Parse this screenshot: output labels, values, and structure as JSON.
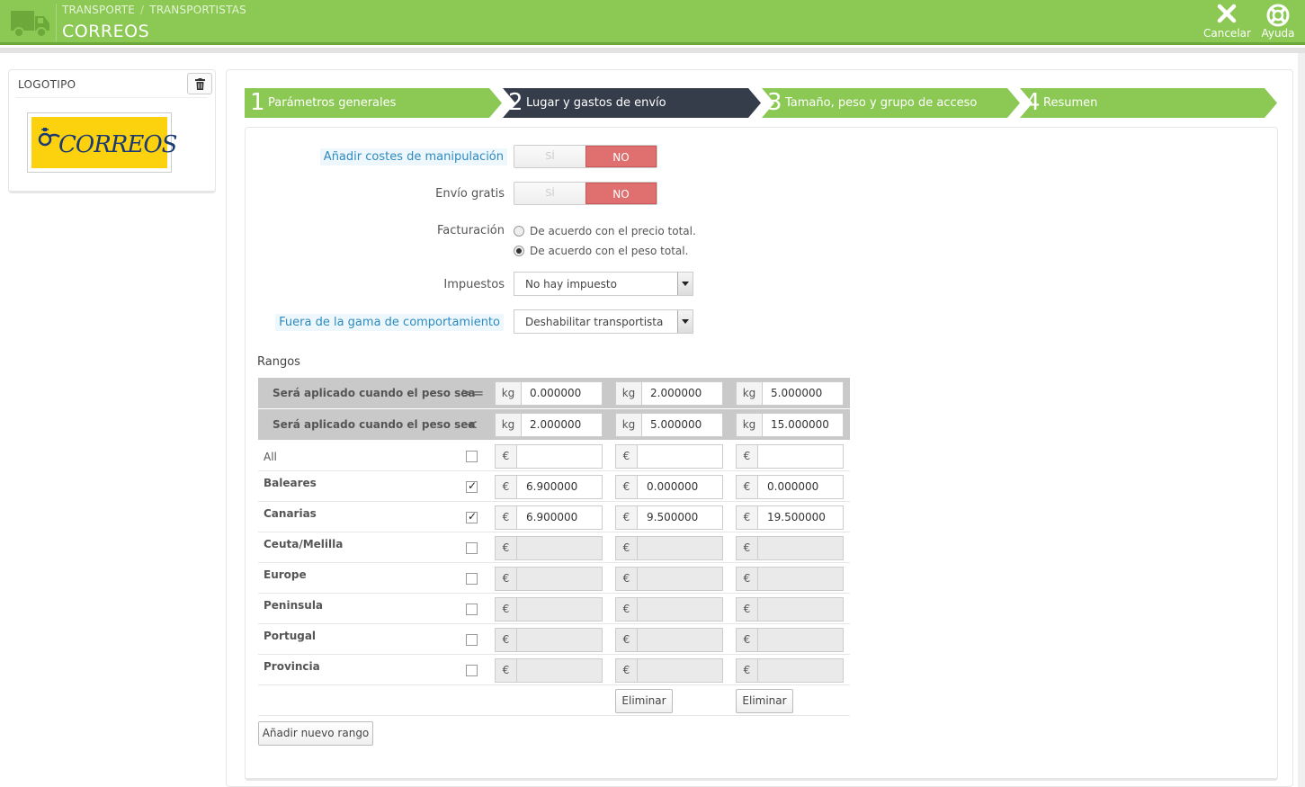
{
  "header": {
    "breadcrumb": [
      "TRANSPORTE",
      "TRANSPORTISTAS"
    ],
    "breadcrumb_sep": "/",
    "title": "CORREOS",
    "cancel_label": "Cancelar",
    "help_label": "Ayuda"
  },
  "logo_panel": {
    "title": "LOGOTIPO",
    "brand_text": "CORREOS"
  },
  "steps": [
    {
      "num": "1",
      "label": "Parámetros generales",
      "active": false
    },
    {
      "num": "2",
      "label": "Lugar y gastos de envío",
      "active": true
    },
    {
      "num": "3",
      "label": "Tamaño, peso y grupo de acceso",
      "active": false
    },
    {
      "num": "4",
      "label": "Resumen",
      "active": false
    }
  ],
  "form": {
    "handling_label": "Añadir costes de manipulación",
    "free_label": "Envío gratis",
    "toggle_yes": "SÍ",
    "toggle_no": "NO",
    "billing_label": "Facturación",
    "billing_options": [
      "De acuerdo con el precio total.",
      "De acuerdo con el peso total."
    ],
    "billing_selected": 1,
    "tax_label": "Impuestos",
    "tax_value": "No hay impuesto",
    "outofrange_label": "Fuera de la gama de comportamiento",
    "outofrange_value": "Deshabilitar transportista"
  },
  "ranges": {
    "title": "Rangos",
    "row_ge_label": "Será aplicado cuando el peso sea",
    "row_ge_op": ">=",
    "row_lt_label": "Será aplicado cuando el peso sea",
    "row_lt_op": "<",
    "unit": "kg",
    "currency": "€",
    "from": [
      "0.000000",
      "2.000000",
      "5.000000"
    ],
    "to": [
      "2.000000",
      "5.000000",
      "15.000000"
    ],
    "zones": [
      {
        "name": "All",
        "checked": false,
        "values": [
          "",
          "",
          ""
        ],
        "enabled": true
      },
      {
        "name": "Baleares",
        "checked": true,
        "values": [
          "6.900000",
          "0.000000",
          "0.000000"
        ],
        "enabled": true
      },
      {
        "name": "Canarias",
        "checked": true,
        "values": [
          "6.900000",
          "9.500000",
          "19.500000"
        ],
        "enabled": true
      },
      {
        "name": "Ceuta/Melilla",
        "checked": false,
        "values": [
          "",
          "",
          ""
        ],
        "enabled": false
      },
      {
        "name": "Europe",
        "checked": false,
        "values": [
          "",
          "",
          ""
        ],
        "enabled": false
      },
      {
        "name": "Peninsula",
        "checked": false,
        "values": [
          "",
          "",
          ""
        ],
        "enabled": false
      },
      {
        "name": "Portugal",
        "checked": false,
        "values": [
          "",
          "",
          ""
        ],
        "enabled": false
      },
      {
        "name": "Provincia",
        "checked": false,
        "values": [
          "",
          "",
          ""
        ],
        "enabled": false
      }
    ],
    "delete_label": "Eliminar",
    "add_range_label": "Añadir nuevo rango"
  },
  "colors": {
    "header_green": "#8bc954",
    "step_dark": "#353c4a",
    "toggle_no": "#e07070",
    "link_blue": "#2c8bc0"
  }
}
